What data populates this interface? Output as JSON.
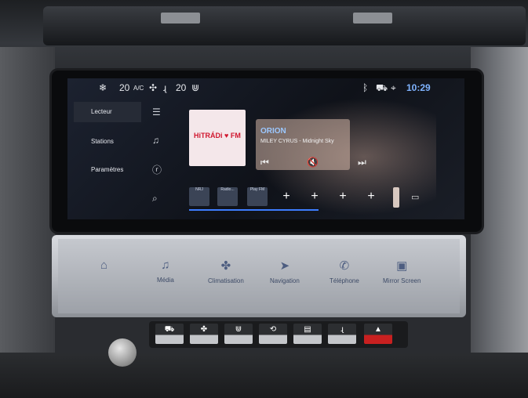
{
  "statusbar": {
    "temp_left": "20",
    "ac_label": "A/C",
    "temp_right": "20",
    "time": "10:29"
  },
  "sidebar": {
    "items": [
      {
        "label": "Lecteur"
      },
      {
        "label": "Stations"
      },
      {
        "label": "Paramètres"
      }
    ]
  },
  "now_playing": {
    "logo_text": "HiTRÁDi ♥ FM",
    "station": "ORION",
    "track": "MILEY CYRUS - Midnight Sky"
  },
  "presets": [
    "NRJ",
    "Radio...",
    "Play FM"
  ],
  "shortcuts": [
    {
      "label": "",
      "icon": "home-icon"
    },
    {
      "label": "Média",
      "icon": "media-icon"
    },
    {
      "label": "Climatisation",
      "icon": "fan-icon"
    },
    {
      "label": "Navigation",
      "icon": "navigation-icon"
    },
    {
      "label": "Téléphone",
      "icon": "phone-icon"
    },
    {
      "label": "Mirror Screen",
      "icon": "mirror-screen-icon"
    }
  ],
  "colors": {
    "accent": "#3d7dff",
    "time": "#7fb3ff",
    "hazard": "#c82020"
  }
}
